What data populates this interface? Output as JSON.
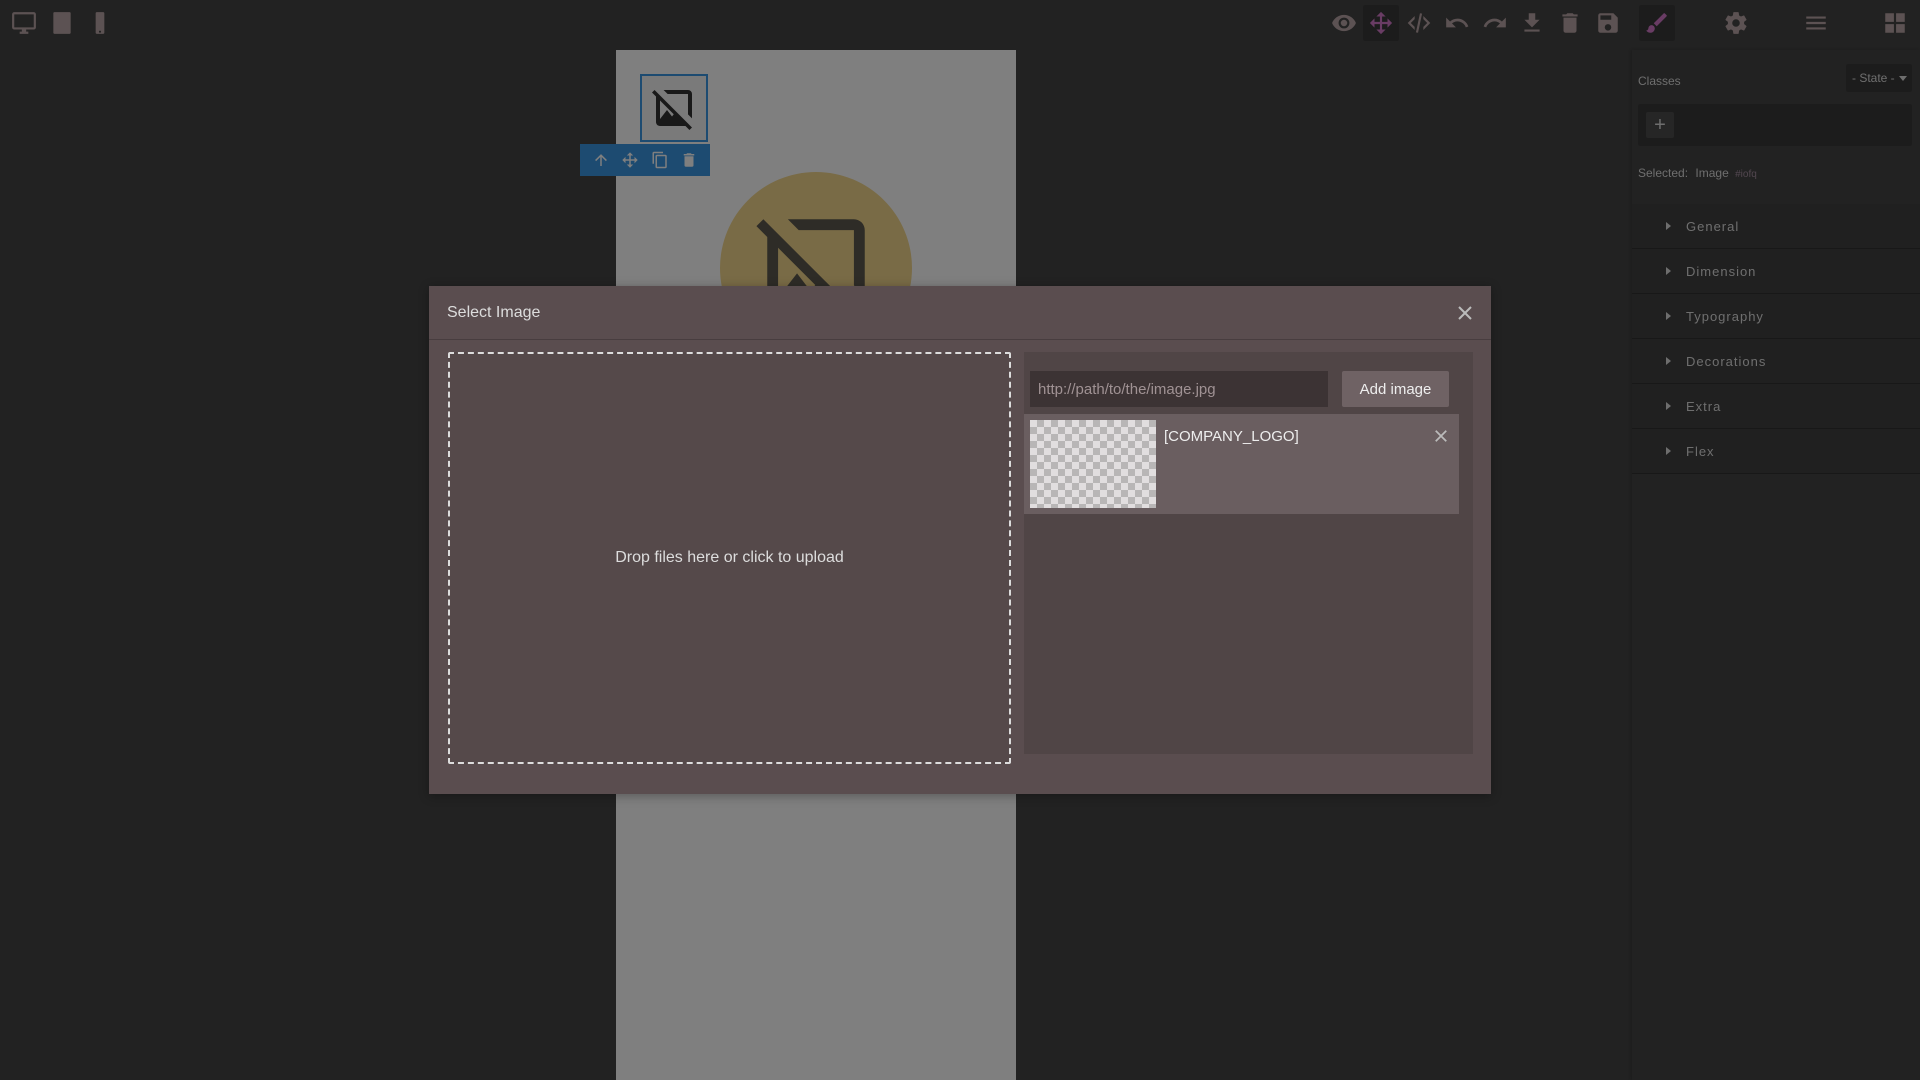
{
  "devices": [
    {
      "name": "desktop-icon"
    },
    {
      "name": "tablet-icon"
    },
    {
      "name": "mobile-icon"
    }
  ],
  "toolbar": {
    "actions": [
      "eye-icon",
      "move-icon",
      "code-icon",
      "undo-icon",
      "redo-icon",
      "import-icon",
      "trash-icon",
      "save-icon",
      "brush-icon"
    ],
    "active_action": "move-icon",
    "panels": [
      "brush-icon",
      "gear-icon",
      "layers-icon",
      "blocks-icon"
    ],
    "active_panel": "brush-icon"
  },
  "component_toolbar": {
    "actions": [
      "arrow-up-icon",
      "move-icon",
      "clone-icon",
      "delete-icon"
    ]
  },
  "style_manager": {
    "classes_label": "Classes",
    "state_label": "- State -",
    "add_class": "+",
    "selected_label": "Selected:",
    "selected_component": "Image",
    "selected_id": "#iofq",
    "sectors": [
      "General",
      "Dimension",
      "Typography",
      "Decorations",
      "Extra",
      "Flex"
    ]
  },
  "modal": {
    "title": "Select Image",
    "dropzone_text": "Drop files here or click to upload",
    "url_placeholder": "http://path/to/the/image.jpg",
    "add_button": "Add image",
    "assets": [
      {
        "name": "[COMPANY_LOGO]"
      }
    ]
  },
  "colors": {
    "accent": "#d278c9",
    "selection": "#3b97e3",
    "panel_bg": "#444444",
    "modal_bg": "#5a4d4f"
  }
}
